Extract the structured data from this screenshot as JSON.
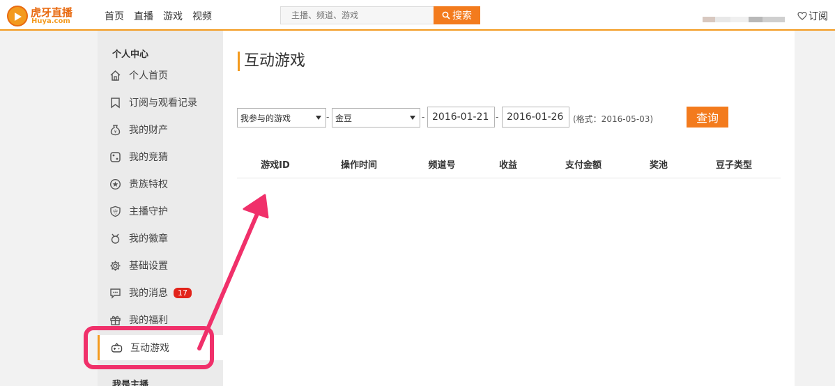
{
  "header": {
    "logo_cn": "虎牙直播",
    "logo_en": "Huya.com",
    "nav": [
      "首页",
      "直播",
      "游戏",
      "视频"
    ],
    "search_placeholder": "主播、频道、游戏",
    "search_button": "搜索",
    "subscribe": "订阅"
  },
  "sidebar": {
    "section_title": "个人中心",
    "items": [
      {
        "label": "个人首页",
        "icon": "home-icon"
      },
      {
        "label": "订阅与观看记录",
        "icon": "bookmark-icon"
      },
      {
        "label": "我的财产",
        "icon": "money-bag-icon"
      },
      {
        "label": "我的竞猜",
        "icon": "dice-icon"
      },
      {
        "label": "贵族特权",
        "icon": "star-circle-icon"
      },
      {
        "label": "主播守护",
        "icon": "shield-icon"
      },
      {
        "label": "我的徽章",
        "icon": "badge-icon"
      },
      {
        "label": "基础设置",
        "icon": "gear-icon"
      },
      {
        "label": "我的消息",
        "icon": "message-icon",
        "badge": "17"
      },
      {
        "label": "我的福利",
        "icon": "gift-icon"
      },
      {
        "label": "互动游戏",
        "icon": "gamepad-icon",
        "active": true
      }
    ],
    "section_title_2": "我是主播"
  },
  "main": {
    "title": "互动游戏",
    "filters": {
      "game_select": "我参与的游戏",
      "currency_select": "金豆",
      "date_from": "2016-01-21",
      "date_to": "2016-01-26",
      "format_hint": "(格式：2016-05-03)",
      "query_button": "查询",
      "separator": "-"
    },
    "table_headers": [
      "游戏ID",
      "操作时间",
      "频道号",
      "收益",
      "支付金额",
      "奖池",
      "豆子类型"
    ]
  },
  "colors": {
    "accent": "#f39a1e",
    "button": "#f37b1d",
    "annotation": "#f0306a",
    "badge": "#e2231a"
  }
}
